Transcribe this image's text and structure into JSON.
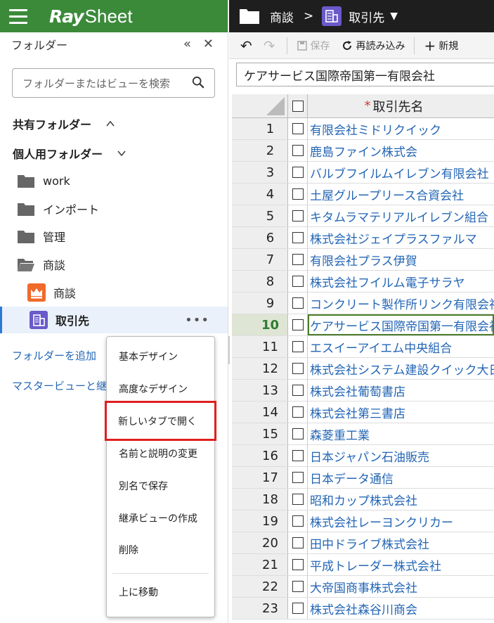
{
  "brand": {
    "ray": "Ray",
    "sheet": "Sheet"
  },
  "panel": {
    "title": "フォルダー",
    "collapse": "«",
    "close": "✕"
  },
  "search": {
    "placeholder": "フォルダーまたはビューを検索"
  },
  "sections": {
    "shared": "共有フォルダー",
    "personal": "個人用フォルダー"
  },
  "tree": [
    {
      "label": "work",
      "icon": "folder-icon"
    },
    {
      "label": "インポート",
      "icon": "folder-icon"
    },
    {
      "label": "管理",
      "icon": "folder-icon"
    },
    {
      "label": "商談",
      "icon": "folder-open-icon"
    },
    {
      "label": "商談",
      "icon": "crown-view-icon",
      "child": true
    },
    {
      "label": "取引先",
      "icon": "grid-view-icon",
      "child": true,
      "active": true
    }
  ],
  "links": {
    "add_folder": "フォルダーを追加",
    "master_view": "マスタービューと継承"
  },
  "topbar": {
    "crumb": "商談",
    "separator": ">",
    "view": "取引先",
    "caret": "▼"
  },
  "toolbar": {
    "undo": "↶",
    "redo": "↷",
    "save": "保存",
    "reload": "再読み込み",
    "new": "新規"
  },
  "formula_value": "ケアサービス国際帝国第一有限会社",
  "grid": {
    "column": "取引先名",
    "required_mark": "*",
    "current_row": 10,
    "rows": [
      {
        "n": "1",
        "v": "有限会社ミドリクイック"
      },
      {
        "n": "2",
        "v": "鹿島ファイン株式会"
      },
      {
        "n": "3",
        "v": "バルブフイルムイレブン有限会社"
      },
      {
        "n": "4",
        "v": "土屋グループリース合資会社"
      },
      {
        "n": "5",
        "v": "キタムラマテリアルイレブン組合"
      },
      {
        "n": "6",
        "v": "株式会社ジェイプラスファルマ"
      },
      {
        "n": "7",
        "v": "有限会社プラス伊賀"
      },
      {
        "n": "8",
        "v": "株式会社フイルム電子サラヤ"
      },
      {
        "n": "9",
        "v": "コンクリート製作所リンク有限会社"
      },
      {
        "n": "10",
        "v": "ケアサービス国際帝国第一有限会社"
      },
      {
        "n": "11",
        "v": "エスイーアイエム中央組合"
      },
      {
        "n": "12",
        "v": "株式会社システム建設クイック大日"
      },
      {
        "n": "13",
        "v": "株式会社葡萄書店"
      },
      {
        "n": "14",
        "v": "株式会社第三書店"
      },
      {
        "n": "15",
        "v": "森菱重工業"
      },
      {
        "n": "16",
        "v": "日本ジャパン石油販売"
      },
      {
        "n": "17",
        "v": "日本データ通信"
      },
      {
        "n": "18",
        "v": "昭和カップ株式会社"
      },
      {
        "n": "19",
        "v": "株式会社レーヨンクリカー"
      },
      {
        "n": "20",
        "v": "田中ドライブ株式会社"
      },
      {
        "n": "21",
        "v": "平成トレーダー株式会社"
      },
      {
        "n": "22",
        "v": "大帝国商事株式会社"
      },
      {
        "n": "23",
        "v": "株式会社森谷川商会"
      }
    ]
  },
  "context_menu": {
    "items": [
      "基本デザイン",
      "高度なデザイン",
      "新しいタブで開く",
      "名前と説明の変更",
      "別名で保存",
      "継承ビューの作成",
      "削除"
    ],
    "highlighted": 2,
    "bottom": "上に移動"
  },
  "colors": {
    "brand_green": "#3b8a3a",
    "link_blue": "#2466b5",
    "highlight_red": "#e02020",
    "active_accent": "#2b79d6"
  }
}
